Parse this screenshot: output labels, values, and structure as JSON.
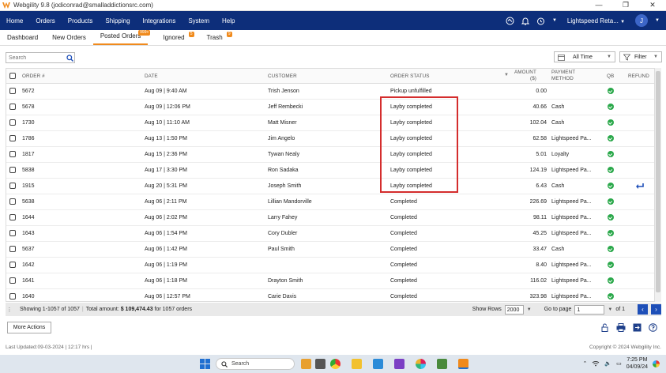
{
  "window": {
    "title": "Webgility 9.8 (jodiconrad@smalladdictionsrc.com)"
  },
  "menu": [
    "Home",
    "Orders",
    "Products",
    "Shipping",
    "Integrations",
    "System",
    "Help"
  ],
  "store_selector": "Lightspeed Reta...",
  "avatar_initial": "J",
  "tabs": [
    {
      "label": "Dashboard",
      "badge": ""
    },
    {
      "label": "New Orders",
      "badge": ""
    },
    {
      "label": "Posted Orders",
      "badge": "999+"
    },
    {
      "label": "Ignored",
      "badge": "5"
    },
    {
      "label": "Trash",
      "badge": "9"
    }
  ],
  "search": {
    "placeholder": "Search"
  },
  "time_filter": "All Time",
  "filter_label": "Filter",
  "columns": {
    "order": "ORDER #",
    "date": "DATE",
    "customer": "CUSTOMER",
    "status": "ORDER STATUS",
    "amount_l1": "AMOUNT",
    "amount_l2": "($)",
    "payment_l1": "PAYMENT",
    "payment_l2": "METHOD",
    "qb": "QB",
    "refund": "REFUND"
  },
  "rows": [
    {
      "order": "5672",
      "date": "Aug 09 | 9:40 AM",
      "customer": "Trish Jenson",
      "status": "Pickup unfulfilled",
      "amount": "0.00",
      "payment": "",
      "qb": true,
      "refund": false
    },
    {
      "order": "5678",
      "date": "Aug 09 | 12:06 PM",
      "customer": "Jeff Rembecki",
      "status": "Layby completed",
      "amount": "40.66",
      "payment": "Cash",
      "qb": true,
      "refund": false
    },
    {
      "order": "1730",
      "date": "Aug 10 | 11:10 AM",
      "customer": "Matt Misner",
      "status": "Layby completed",
      "amount": "102.04",
      "payment": "Cash",
      "qb": true,
      "refund": false
    },
    {
      "order": "1786",
      "date": "Aug 13 | 1:50 PM",
      "customer": "Jim Angelo",
      "status": "Layby completed",
      "amount": "62.58",
      "payment": "Lightspeed Pa...",
      "qb": true,
      "refund": false
    },
    {
      "order": "1817",
      "date": "Aug 15 | 2:36 PM",
      "customer": "Tywan Nealy",
      "status": "Layby completed",
      "amount": "5.01",
      "payment": "Loyalty",
      "qb": true,
      "refund": false
    },
    {
      "order": "5838",
      "date": "Aug 17 | 3:30 PM",
      "customer": "Ron Sadaka",
      "status": "Layby completed",
      "amount": "124.19",
      "payment": "Lightspeed Pa...",
      "qb": true,
      "refund": false
    },
    {
      "order": "1915",
      "date": "Aug 20 | 5:31 PM",
      "customer": "Joseph Smith",
      "status": "Layby completed",
      "amount": "6.43",
      "payment": "Cash",
      "qb": true,
      "refund": true
    },
    {
      "order": "5638",
      "date": "Aug 06 | 2:11 PM",
      "customer": "Lillian Mandorville",
      "status": "Completed",
      "amount": "226.69",
      "payment": "Lightspeed Pa...",
      "qb": true,
      "refund": false
    },
    {
      "order": "1644",
      "date": "Aug 06 | 2:02 PM",
      "customer": "Larry Fahey",
      "status": "Completed",
      "amount": "98.11",
      "payment": "Lightspeed Pa...",
      "qb": true,
      "refund": false
    },
    {
      "order": "1643",
      "date": "Aug 06 | 1:54 PM",
      "customer": "Cory Dubler",
      "status": "Completed",
      "amount": "45.25",
      "payment": "Lightspeed Pa...",
      "qb": true,
      "refund": false
    },
    {
      "order": "5637",
      "date": "Aug 06 | 1:42 PM",
      "customer": "Paul Smith",
      "status": "Completed",
      "amount": "33.47",
      "payment": "Cash",
      "qb": true,
      "refund": false
    },
    {
      "order": "1642",
      "date": "Aug 06 | 1:19 PM",
      "customer": "",
      "status": "Completed",
      "amount": "8.40",
      "payment": "Lightspeed Pa...",
      "qb": true,
      "refund": false
    },
    {
      "order": "1641",
      "date": "Aug 06 | 1:18 PM",
      "customer": "Drayton Smith",
      "status": "Completed",
      "amount": "116.02",
      "payment": "Lightspeed Pa...",
      "qb": true,
      "refund": false
    },
    {
      "order": "1640",
      "date": "Aug 06 | 12:57 PM",
      "customer": "Carie Davis",
      "status": "Completed",
      "amount": "323.98",
      "payment": "Lightspeed Pa...",
      "qb": true,
      "refund": false
    }
  ],
  "footer": {
    "showing": "Showing 1-1057 of 1057",
    "total_label": "Total amount:",
    "total_value": "$ 109,474.43",
    "for_orders": "for 1057 orders",
    "show_rows_label": "Show Rows",
    "rows_value": "2000",
    "goto_label": "Go to page",
    "page_value": "1",
    "of_label": "of 1"
  },
  "more_actions_label": "More Actions",
  "last_updated": "Last Updated:09-03-2024 | 12:17 hrs |",
  "copyright": "Copyright © 2024 Webgility Inc.",
  "taskbar": {
    "search_placeholder": "Search",
    "time": "7:25 PM",
    "date": "04/09/24"
  },
  "colors": {
    "menubar": "#0d2e7a",
    "accent": "#f08a1c",
    "qb_check": "#2aa84a",
    "highlight": "#d42d2d",
    "refund_icon": "#1e4fb8"
  }
}
